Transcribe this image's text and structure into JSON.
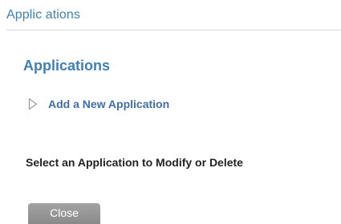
{
  "header": {
    "title": "Applic ations"
  },
  "main": {
    "section_title": "Applications",
    "add_link_label": "Add a New Application",
    "select_prompt": "Select an Application to Modify or Delete",
    "close_label": "Close"
  },
  "icons": {
    "add_link_icon": "triangle-right-outline-icon"
  },
  "colors": {
    "accent": "#3f7fb3",
    "link": "#3f6fa6",
    "button_bg": "#969696",
    "text": "#222222",
    "divider": "#d9d9d9"
  }
}
